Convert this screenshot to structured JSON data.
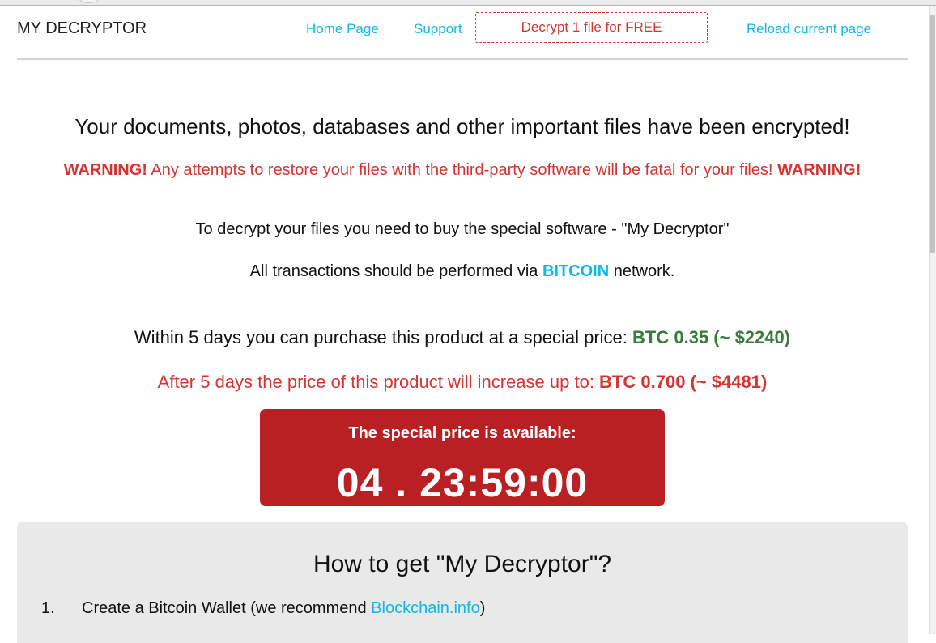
{
  "header": {
    "brand": "MY DECRYPTOR",
    "nav": {
      "home": "Home Page",
      "support": "Support",
      "free": "Decrypt 1 file for FREE",
      "reload": "Reload current page"
    }
  },
  "main": {
    "headline": "Your documents, photos, databases and other important files have been encrypted!",
    "warning": {
      "tag_left": "WARNING!",
      "text": " Any attempts to restore your files with the third-party software will be fatal for your files! ",
      "tag_right": "WARNING!"
    },
    "line1": "To decrypt your files you need to buy the special software - \"My Decryptor\"",
    "line2": {
      "before": "All transactions should be performed via ",
      "bitcoin": "BITCOIN",
      "after": " network."
    },
    "price_special": {
      "text": "Within 5 days you can purchase this product at a special price: ",
      "amount": "BTC 0.35 (~ $2240)"
    },
    "price_increase": {
      "text": "After 5 days the price of this product will increase up to: ",
      "amount": "BTC 0.700 (~ $4481)"
    },
    "countdown": {
      "label": "The special price is available:",
      "timer": "04 . 23:59:00"
    }
  },
  "howto": {
    "title": "How to get \"My Decryptor\"?",
    "steps": [
      {
        "number": "1.",
        "text_before": "Create a Bitcoin Wallet (we recommend ",
        "link": "Blockchain.info",
        "text_after": ")"
      }
    ]
  },
  "colors": {
    "accent_blue": "#11b8e6",
    "warning_red": "#d63333",
    "price_green": "#3a7a3a",
    "countdown_bg": "#b82023"
  }
}
